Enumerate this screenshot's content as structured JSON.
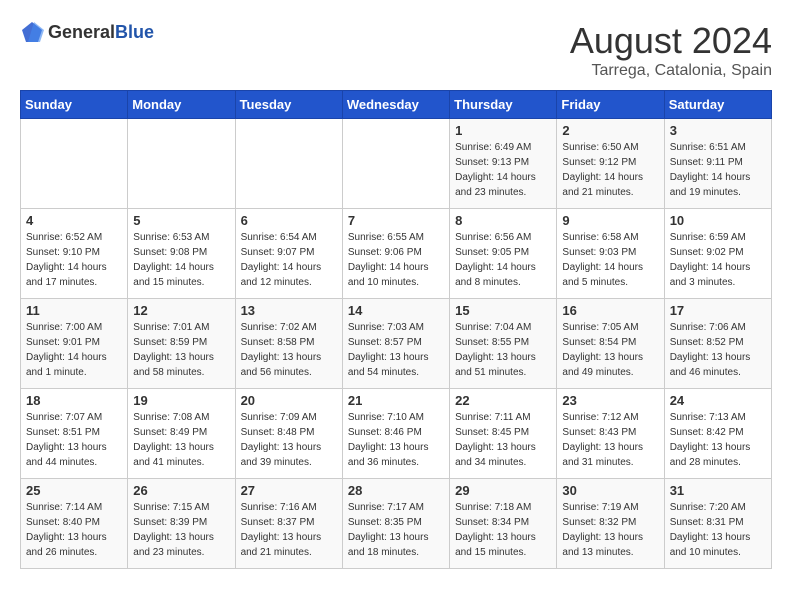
{
  "header": {
    "logo_general": "General",
    "logo_blue": "Blue",
    "month": "August 2024",
    "location": "Tarrega, Catalonia, Spain"
  },
  "weekdays": [
    "Sunday",
    "Monday",
    "Tuesday",
    "Wednesday",
    "Thursday",
    "Friday",
    "Saturday"
  ],
  "weeks": [
    [
      {
        "day": "",
        "info": ""
      },
      {
        "day": "",
        "info": ""
      },
      {
        "day": "",
        "info": ""
      },
      {
        "day": "",
        "info": ""
      },
      {
        "day": "1",
        "info": "Sunrise: 6:49 AM\nSunset: 9:13 PM\nDaylight: 14 hours\nand 23 minutes."
      },
      {
        "day": "2",
        "info": "Sunrise: 6:50 AM\nSunset: 9:12 PM\nDaylight: 14 hours\nand 21 minutes."
      },
      {
        "day": "3",
        "info": "Sunrise: 6:51 AM\nSunset: 9:11 PM\nDaylight: 14 hours\nand 19 minutes."
      }
    ],
    [
      {
        "day": "4",
        "info": "Sunrise: 6:52 AM\nSunset: 9:10 PM\nDaylight: 14 hours\nand 17 minutes."
      },
      {
        "day": "5",
        "info": "Sunrise: 6:53 AM\nSunset: 9:08 PM\nDaylight: 14 hours\nand 15 minutes."
      },
      {
        "day": "6",
        "info": "Sunrise: 6:54 AM\nSunset: 9:07 PM\nDaylight: 14 hours\nand 12 minutes."
      },
      {
        "day": "7",
        "info": "Sunrise: 6:55 AM\nSunset: 9:06 PM\nDaylight: 14 hours\nand 10 minutes."
      },
      {
        "day": "8",
        "info": "Sunrise: 6:56 AM\nSunset: 9:05 PM\nDaylight: 14 hours\nand 8 minutes."
      },
      {
        "day": "9",
        "info": "Sunrise: 6:58 AM\nSunset: 9:03 PM\nDaylight: 14 hours\nand 5 minutes."
      },
      {
        "day": "10",
        "info": "Sunrise: 6:59 AM\nSunset: 9:02 PM\nDaylight: 14 hours\nand 3 minutes."
      }
    ],
    [
      {
        "day": "11",
        "info": "Sunrise: 7:00 AM\nSunset: 9:01 PM\nDaylight: 14 hours\nand 1 minute."
      },
      {
        "day": "12",
        "info": "Sunrise: 7:01 AM\nSunset: 8:59 PM\nDaylight: 13 hours\nand 58 minutes."
      },
      {
        "day": "13",
        "info": "Sunrise: 7:02 AM\nSunset: 8:58 PM\nDaylight: 13 hours\nand 56 minutes."
      },
      {
        "day": "14",
        "info": "Sunrise: 7:03 AM\nSunset: 8:57 PM\nDaylight: 13 hours\nand 54 minutes."
      },
      {
        "day": "15",
        "info": "Sunrise: 7:04 AM\nSunset: 8:55 PM\nDaylight: 13 hours\nand 51 minutes."
      },
      {
        "day": "16",
        "info": "Sunrise: 7:05 AM\nSunset: 8:54 PM\nDaylight: 13 hours\nand 49 minutes."
      },
      {
        "day": "17",
        "info": "Sunrise: 7:06 AM\nSunset: 8:52 PM\nDaylight: 13 hours\nand 46 minutes."
      }
    ],
    [
      {
        "day": "18",
        "info": "Sunrise: 7:07 AM\nSunset: 8:51 PM\nDaylight: 13 hours\nand 44 minutes."
      },
      {
        "day": "19",
        "info": "Sunrise: 7:08 AM\nSunset: 8:49 PM\nDaylight: 13 hours\nand 41 minutes."
      },
      {
        "day": "20",
        "info": "Sunrise: 7:09 AM\nSunset: 8:48 PM\nDaylight: 13 hours\nand 39 minutes."
      },
      {
        "day": "21",
        "info": "Sunrise: 7:10 AM\nSunset: 8:46 PM\nDaylight: 13 hours\nand 36 minutes."
      },
      {
        "day": "22",
        "info": "Sunrise: 7:11 AM\nSunset: 8:45 PM\nDaylight: 13 hours\nand 34 minutes."
      },
      {
        "day": "23",
        "info": "Sunrise: 7:12 AM\nSunset: 8:43 PM\nDaylight: 13 hours\nand 31 minutes."
      },
      {
        "day": "24",
        "info": "Sunrise: 7:13 AM\nSunset: 8:42 PM\nDaylight: 13 hours\nand 28 minutes."
      }
    ],
    [
      {
        "day": "25",
        "info": "Sunrise: 7:14 AM\nSunset: 8:40 PM\nDaylight: 13 hours\nand 26 minutes."
      },
      {
        "day": "26",
        "info": "Sunrise: 7:15 AM\nSunset: 8:39 PM\nDaylight: 13 hours\nand 23 minutes."
      },
      {
        "day": "27",
        "info": "Sunrise: 7:16 AM\nSunset: 8:37 PM\nDaylight: 13 hours\nand 21 minutes."
      },
      {
        "day": "28",
        "info": "Sunrise: 7:17 AM\nSunset: 8:35 PM\nDaylight: 13 hours\nand 18 minutes."
      },
      {
        "day": "29",
        "info": "Sunrise: 7:18 AM\nSunset: 8:34 PM\nDaylight: 13 hours\nand 15 minutes."
      },
      {
        "day": "30",
        "info": "Sunrise: 7:19 AM\nSunset: 8:32 PM\nDaylight: 13 hours\nand 13 minutes."
      },
      {
        "day": "31",
        "info": "Sunrise: 7:20 AM\nSunset: 8:31 PM\nDaylight: 13 hours\nand 10 minutes."
      }
    ]
  ]
}
